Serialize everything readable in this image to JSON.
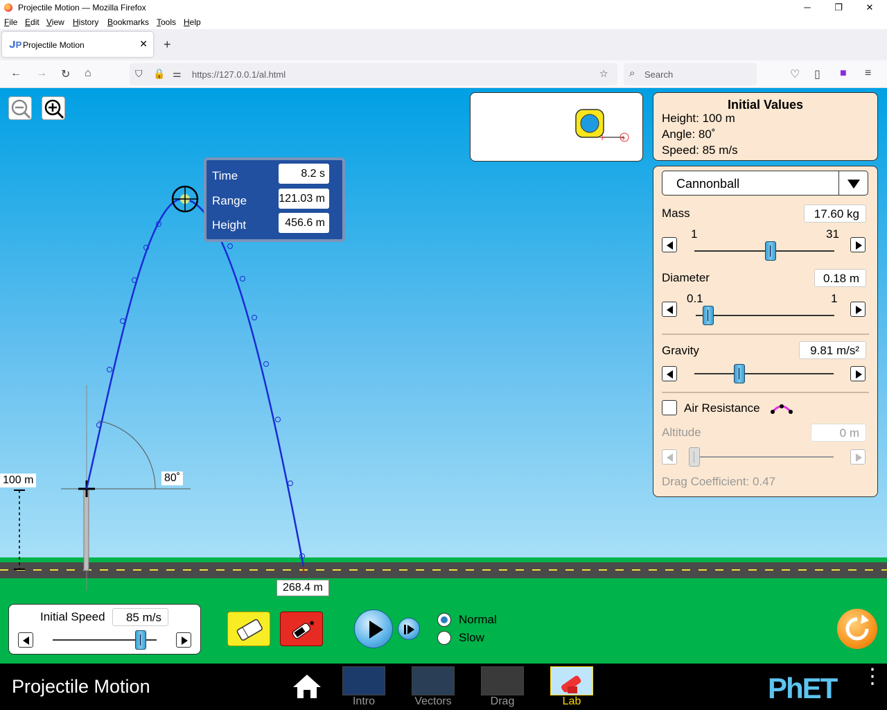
{
  "browser": {
    "window_title": "Projectile Motion — Mozilla Firefox",
    "menu": [
      "File",
      "Edit",
      "View",
      "History",
      "Bookmarks",
      "Tools",
      "Help"
    ],
    "tab_title": "Projectile Motion",
    "url": "https://127.0.0.1/al.html",
    "search_placeholder": "Search"
  },
  "sim": {
    "initial_values": {
      "title": "Initial Values",
      "height": "Height: 100 m",
      "angle": "Angle: 80˚",
      "speed": "Speed: 85 m/s"
    },
    "projectile": "Cannonball",
    "mass": {
      "label": "Mass",
      "value": "17.60 kg",
      "min": "1",
      "max": "31",
      "level": 0.55
    },
    "diameter": {
      "label": "Diameter",
      "value": "0.18 m",
      "min": "0.1",
      "max": "1",
      "level": 0.09
    },
    "gravity": {
      "label": "Gravity",
      "value": "9.81 m/s²",
      "level": 0.3
    },
    "air_resistance": {
      "label": "Air Resistance",
      "checked": false
    },
    "altitude": {
      "label": "Altitude",
      "value": "0 m",
      "level": 0.0
    },
    "drag_coefficient": "Drag Coefficient: 0.47",
    "readout": {
      "time_label": "Time",
      "time": "8.2 s",
      "range_label": "Range",
      "range": "121.03 m",
      "height_label": "Height",
      "height": "456.6 m"
    },
    "height_marker": "100 m",
    "angle_marker": "80˚",
    "landing_marker": "268.4 m",
    "initial_speed": {
      "label": "Initial Speed",
      "value": "85 m/s",
      "level": 0.85
    },
    "speed_options": {
      "normal": "Normal",
      "slow": "Slow",
      "selected": "Normal"
    }
  },
  "footer": {
    "title": "Projectile Motion",
    "screens": [
      "Intro",
      "Vectors",
      "Drag",
      "Lab"
    ],
    "selected_screen": "Lab",
    "logo": "PhET"
  },
  "colors": {
    "sky": "#00a0e4",
    "panel": "#fce8d2",
    "ground": "#00b34a",
    "readout": "#2250a0",
    "trajectory": "#1a2bd6"
  }
}
